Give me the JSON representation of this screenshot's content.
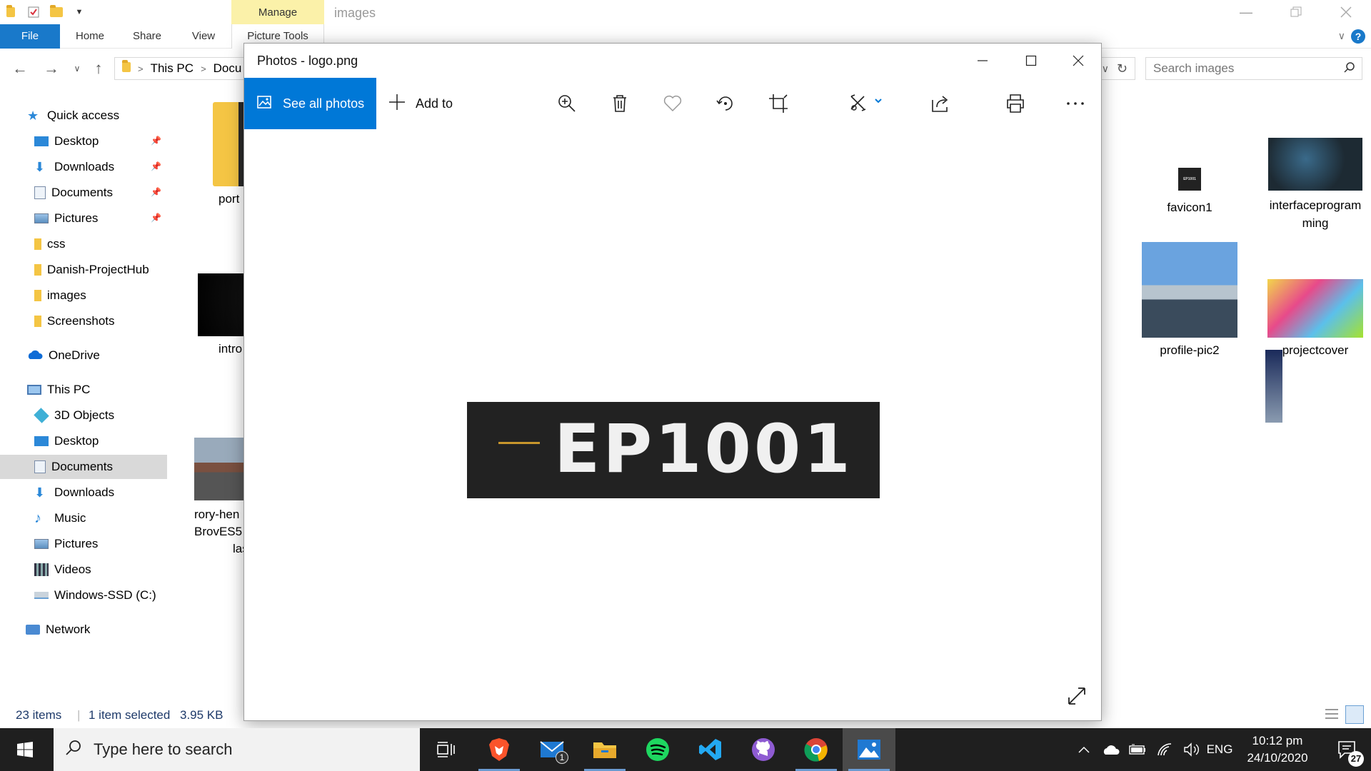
{
  "explorer": {
    "window_title": "images",
    "manage_tab": "Manage",
    "ribbon": {
      "file": "File",
      "home": "Home",
      "share": "Share",
      "view": "View",
      "picture_tools": "Picture Tools"
    },
    "breadcrumb": [
      "This PC",
      "Docu"
    ],
    "search_placeholder": "Search images",
    "nav": [
      {
        "label": "Quick access"
      },
      {
        "label": "Desktop"
      },
      {
        "label": "Downloads"
      },
      {
        "label": "Documents"
      },
      {
        "label": "Pictures"
      },
      {
        "label": "css"
      },
      {
        "label": "Danish-ProjectHub"
      },
      {
        "label": "images"
      },
      {
        "label": "Screenshots"
      },
      {
        "label": "OneDrive"
      },
      {
        "label": "This PC"
      },
      {
        "label": "3D Objects"
      },
      {
        "label": "Desktop"
      },
      {
        "label": "Documents"
      },
      {
        "label": "Downloads"
      },
      {
        "label": "Music"
      },
      {
        "label": "Pictures"
      },
      {
        "label": "Videos"
      },
      {
        "label": "Windows-SSD (C:)"
      },
      {
        "label": "Network"
      }
    ],
    "files": [
      {
        "name": "port"
      },
      {
        "name": "intro"
      },
      {
        "name_lines": [
          "rory-hen",
          "BrovES5",
          "las"
        ]
      },
      {
        "name": "favicon1"
      },
      {
        "name_lines": [
          "interfaceprogram",
          "ming"
        ]
      },
      {
        "name": "profile-pic2"
      },
      {
        "name": "projectcover"
      }
    ],
    "favicon_text": "EP1001",
    "status": {
      "items": "23 items",
      "selected": "1 item selected",
      "size": "3.95 KB"
    }
  },
  "photos": {
    "title": "Photos - logo.png",
    "see_all": "See all photos",
    "add_to": "Add to",
    "image_text": "EP1001",
    "accent": "#0078d7"
  },
  "taskbar": {
    "search_placeholder": "Type here to search",
    "mail_badge": "1",
    "language": "ENG",
    "time": "10:12 pm",
    "date": "24/10/2020",
    "notification_count": "27"
  }
}
